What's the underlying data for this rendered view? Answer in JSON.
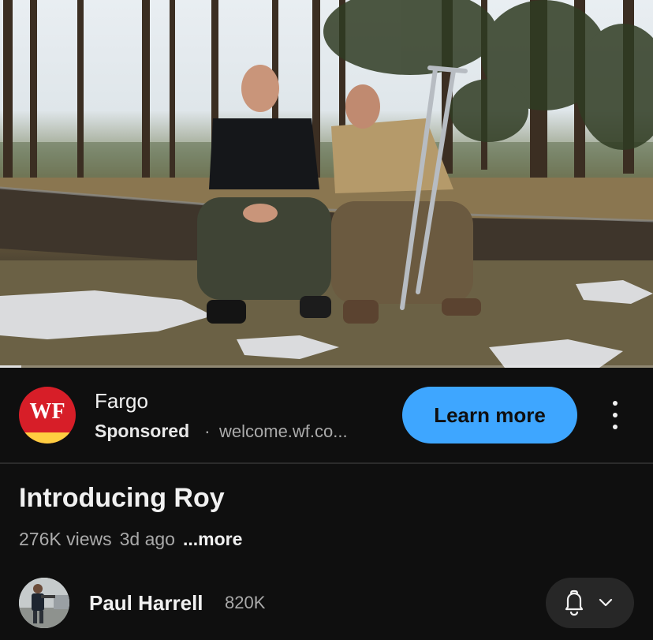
{
  "ad": {
    "logo_text": "WF",
    "advertiser": "Fargo",
    "sponsored_label": "Sponsored",
    "separator": "·",
    "url": "welcome.wf.co...",
    "cta_label": "Learn more",
    "brand_colors": {
      "red": "#d71e28",
      "yellow": "#ffcd41"
    },
    "cta_color": "#3ea6ff",
    "menu_icon": "more-vertical-icon"
  },
  "player": {
    "progress_fraction": 0.033
  },
  "video": {
    "title": "Introducing Roy",
    "views": "276K views",
    "age": "3d ago",
    "more_label": "...more"
  },
  "channel": {
    "name": "Paul Harrell",
    "subscribers": "820K",
    "bell_icon": "bell-icon",
    "chevron_icon": "chevron-down-icon"
  }
}
